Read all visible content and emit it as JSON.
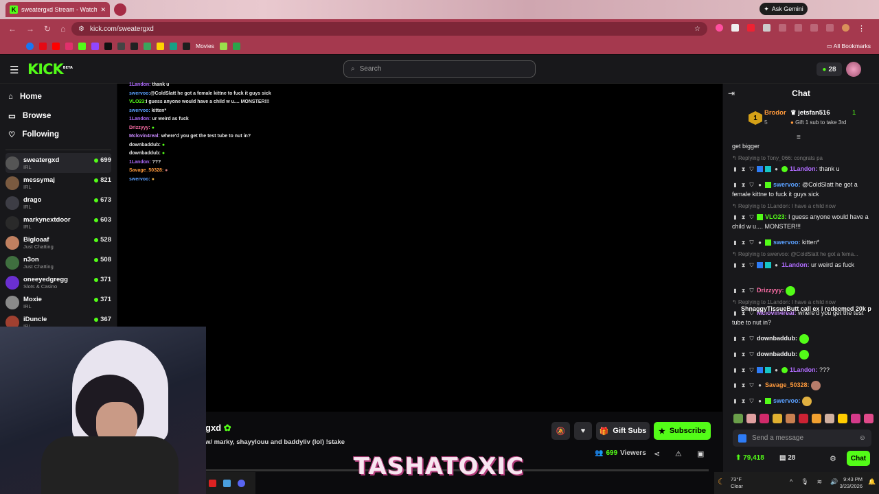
{
  "browser": {
    "tab_title": "sweatergxd Stream - Watch Liv",
    "gemini": "Ask Gemini",
    "url": "kick.com/sweatergxd",
    "bookmarks_movies": "Movies",
    "all_bookmarks": "All Bookmarks"
  },
  "header": {
    "logo": "KICK",
    "logo_sup": "BETA",
    "search_placeholder": "Search",
    "coins": "28"
  },
  "nav": {
    "home": "Home",
    "browse": "Browse",
    "following": "Following"
  },
  "channels": [
    {
      "name": "sweatergxd",
      "category": "IRL",
      "viewers": "699"
    },
    {
      "name": "messymaj",
      "category": "IRL",
      "viewers": "821"
    },
    {
      "name": "drago",
      "category": "IRL",
      "viewers": "673"
    },
    {
      "name": "markynextdoor",
      "category": "IRL",
      "viewers": "603"
    },
    {
      "name": "Bigloaaf",
      "category": "Just Chatting",
      "viewers": "528"
    },
    {
      "name": "n3on",
      "category": "Just Chatting",
      "viewers": "508"
    },
    {
      "name": "oneeyedgregg",
      "category": "Slots & Casino",
      "viewers": "371"
    },
    {
      "name": "Moxie",
      "category": "IRL",
      "viewers": "371"
    },
    {
      "name": "iDuncle",
      "category": "IRL",
      "viewers": "367"
    }
  ],
  "overlay_chat": [
    {
      "user": "1Landon:",
      "text": "thank u",
      "color": "#b06cff"
    },
    {
      "user": "swervoo:",
      "text": "@ColdSlatt he got a female kittne to fuck it guys sick",
      "color": "#5aa0ff"
    },
    {
      "user": "VLO23:",
      "text": "I guess anyone would have a child w u.... MONSTER!!!",
      "color": "#53fc18"
    },
    {
      "user": "swervoo:",
      "text": "kitten*",
      "color": "#5aa0ff"
    },
    {
      "user": "1Landon:",
      "text": "ur weird as fuck",
      "color": "#b06cff"
    },
    {
      "user": "Drizzyyy:",
      "text": "",
      "color": "#ff6fa8"
    },
    {
      "user": "Mclovin4real:",
      "text": "where'd you get the test tube to nut in?",
      "color": "#c98aff"
    },
    {
      "user": "downbaddub:",
      "text": "",
      "color": "#f2f2f2"
    },
    {
      "user": "downbaddub:",
      "text": "",
      "color": "#f2f2f2"
    },
    {
      "user": "1Landon:",
      "text": "???",
      "color": "#b06cff"
    },
    {
      "user": "Savage_50328:",
      "text": "",
      "color": "#ff9a3c"
    },
    {
      "user": "swervoo:",
      "text": "",
      "color": "#5aa0ff"
    }
  ],
  "stream": {
    "name_partial": "gxd",
    "title_partial": "w/ marky, shayylouu and baddyliv (lol) !stake",
    "gift_subs": "Gift Subs",
    "subscribe": "Subscribe",
    "viewers": "699",
    "viewers_label": "Viewers",
    "watermark": "TASHATOXIC"
  },
  "chat": {
    "title": "Chat",
    "lb1_name": "Brodor",
    "lb1_val": "5",
    "lb2_name": "jetsfan516",
    "lb2_val": "1",
    "lb2_note": "Gift 1 sub to take 3rd",
    "partial_top": "get bigger",
    "messages": [
      {
        "reply": "Replying to Tony_066: congrats pa",
        "user": "1Landon:",
        "text": "thank u",
        "color": "#b06cff"
      },
      {
        "reply": "",
        "user": "swervoo:",
        "text": "@ColdSlatt he got a female kittne to fuck it guys sick",
        "color": "#5aa0ff"
      },
      {
        "reply": "Replying to 1Landon: I have a child now",
        "user": "VLO23:",
        "text": "I guess anyone would have a child w u.... MONSTER!!!",
        "color": "#53fc18"
      },
      {
        "reply": "",
        "user": "swervoo:",
        "text": "kitten*",
        "color": "#5aa0ff"
      },
      {
        "reply": "Replying to swervoo: @ColdSlatt he got a fema...",
        "user": "1Landon:",
        "text": "ur weird as fuck",
        "color": "#b06cff"
      },
      {
        "reply": "",
        "user": "Drizzyyy:",
        "text": "",
        "color": "#ff6fa8"
      },
      {
        "reply": "Replying to 1Landon: I have a child now",
        "user": "Mclovin4real:",
        "text": "where'd you get the test tube to nut in?",
        "color": "#c98aff"
      },
      {
        "reply": "",
        "user": "downbaddub:",
        "text": "",
        "color": "#f2f2f2"
      },
      {
        "reply": "",
        "user": "downbaddub:",
        "text": "",
        "color": "#f2f2f2"
      },
      {
        "reply": "",
        "user": "1Landon:",
        "text": "???",
        "color": "#b06cff"
      },
      {
        "reply": "",
        "user": "Savage_50328:",
        "text": "",
        "color": "#ff9a3c"
      },
      {
        "reply": "",
        "user": "swervoo:",
        "text": "",
        "color": "#5aa0ff"
      }
    ],
    "ticker": "ShnaggyTissueButt call ex i redeemed 20k p",
    "input_placeholder": "Send a message",
    "points": "79,418",
    "subs": "28",
    "send": "Chat"
  },
  "taskbar": {
    "temp": "73°F",
    "weather": "Clear",
    "time": "9:43 PM",
    "date": "3/23/2026"
  },
  "colors": {
    "kick_green": "#53fc18",
    "browser": "#a5394e"
  }
}
